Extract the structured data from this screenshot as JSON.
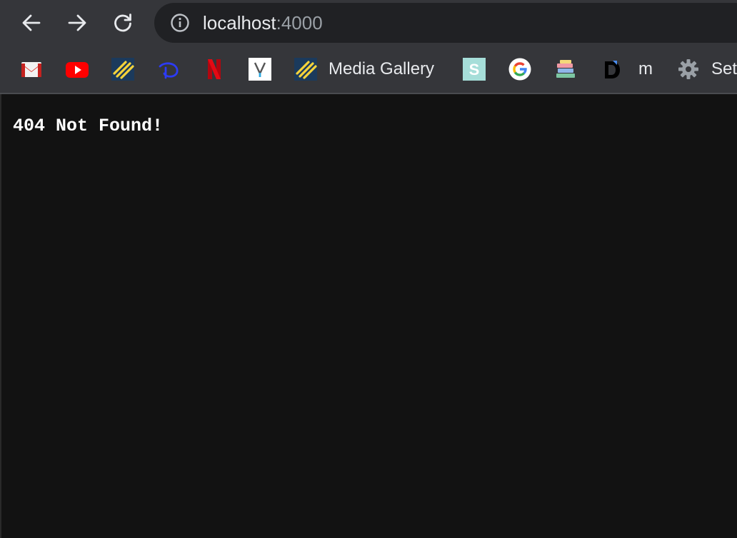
{
  "toolbar": {
    "back_icon": "arrow-left-icon",
    "forward_icon": "arrow-right-icon",
    "reload_icon": "reload-icon",
    "info_icon": "info-icon",
    "url_host": "localhost",
    "url_port": ":4000"
  },
  "bookmarks": {
    "items": [
      {
        "icon": "gmail-icon",
        "label": ""
      },
      {
        "icon": "youtube-icon",
        "label": ""
      },
      {
        "icon": "yellow-stripes-icon",
        "label": ""
      },
      {
        "icon": "disney-plus-icon",
        "label": ""
      },
      {
        "icon": "netflix-icon",
        "label": ""
      },
      {
        "icon": "v-letter-icon",
        "label": ""
      },
      {
        "icon": "yellow-stripes-icon",
        "label": "Media Gallery"
      },
      {
        "icon": "s-letter-icon",
        "label": ""
      },
      {
        "icon": "google-icon",
        "label": ""
      },
      {
        "icon": "books-icon",
        "label": ""
      },
      {
        "icon": "d-letter-icon",
        "label": ""
      },
      {
        "icon": "",
        "label": "m"
      },
      {
        "icon": "gear-icon",
        "label": "Set"
      }
    ]
  },
  "page": {
    "message": "404 Not Found!"
  },
  "colors": {
    "toolbar_bg": "#35363a",
    "omnibox_bg": "#202124",
    "page_bg": "#121212",
    "text": "#e8eaed",
    "muted_text": "#9aa0a6"
  }
}
